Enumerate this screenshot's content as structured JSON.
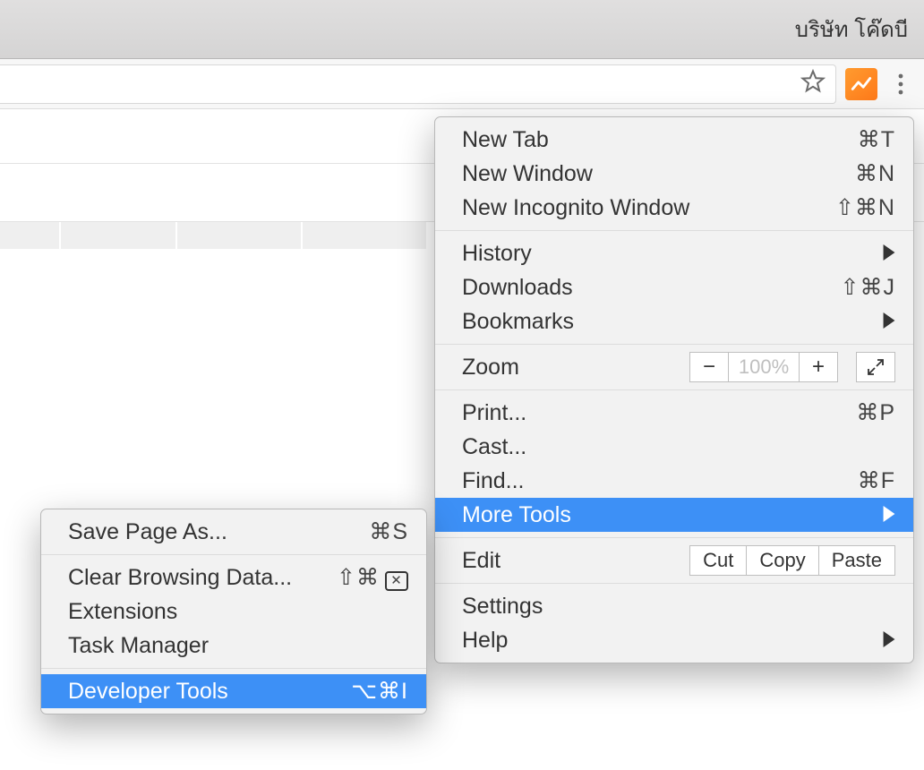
{
  "titlebar": {
    "text": "บริษัท โค๊ดบี"
  },
  "menu": {
    "new_tab": {
      "label": "New Tab",
      "accel": "⌘T"
    },
    "new_window": {
      "label": "New Window",
      "accel": "⌘N"
    },
    "new_incognito": {
      "label": "New Incognito Window",
      "accel": "⇧⌘N"
    },
    "history": {
      "label": "History"
    },
    "downloads": {
      "label": "Downloads",
      "accel": "⇧⌘J"
    },
    "bookmarks": {
      "label": "Bookmarks"
    },
    "zoom": {
      "label": "Zoom",
      "value": "100%"
    },
    "print": {
      "label": "Print...",
      "accel": "⌘P"
    },
    "cast": {
      "label": "Cast..."
    },
    "find": {
      "label": "Find...",
      "accel": "⌘F"
    },
    "more_tools": {
      "label": "More Tools"
    },
    "edit": {
      "label": "Edit",
      "cut": "Cut",
      "copy": "Copy",
      "paste": "Paste"
    },
    "settings": {
      "label": "Settings"
    },
    "help": {
      "label": "Help"
    }
  },
  "submenu": {
    "save_page": {
      "label": "Save Page As...",
      "accel": "⌘S"
    },
    "clear_browsing": {
      "label": "Clear Browsing Data...",
      "accel": "⇧⌘"
    },
    "extensions": {
      "label": "Extensions"
    },
    "task_manager": {
      "label": "Task Manager"
    },
    "devtools": {
      "label": "Developer Tools",
      "accel": "⌥⌘I"
    }
  }
}
